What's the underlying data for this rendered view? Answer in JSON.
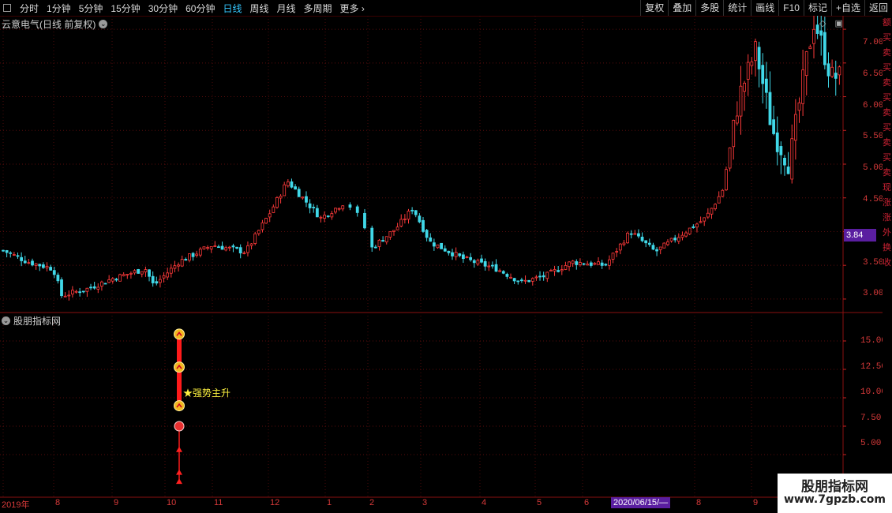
{
  "toolbar": {
    "periods": [
      "分时",
      "1分钟",
      "5分钟",
      "15分钟",
      "30分钟",
      "60分钟",
      "日线",
      "周线",
      "月线",
      "多周期",
      "更多"
    ],
    "active_period": "日线",
    "right_tools": [
      "复权",
      "叠加",
      "多股",
      "统计",
      "画线",
      "F10",
      "标记",
      "+自选",
      "返回"
    ]
  },
  "main_panel": {
    "title": "云意电气(日线 前复权)",
    "current_price": "3.84",
    "y_ticks": [
      "7.00",
      "6.50",
      "6.00",
      "5.50",
      "5.00",
      "4.50",
      "4.00",
      "3.50",
      "3.00"
    ]
  },
  "indicator_panel": {
    "title": "股朋指标网",
    "y_ticks": [
      "15.00",
      "12.50",
      "10.00",
      "7.50",
      "5.00"
    ],
    "signal_label": "★强势主升"
  },
  "time_axis": {
    "labels": [
      "2019年",
      "8",
      "9",
      "10",
      "11",
      "12",
      "1",
      "2",
      "3",
      "4",
      "5",
      "6",
      "8",
      "9"
    ],
    "cursor_date": "2020/06/15/—"
  },
  "right_strip": [
    "额",
    "买",
    "卖",
    "买",
    "卖",
    "买",
    "卖",
    "买",
    "卖",
    "买",
    "卖",
    "现",
    "涨",
    "涨",
    "外",
    "换",
    "收"
  ],
  "watermark": {
    "name": "股朋指标网",
    "url": "www.7gpzb.com"
  },
  "colors": {
    "up": "#ff3a3a",
    "down": "#40d8e8",
    "accent": "#35c7ff",
    "highlight": "#5a1ea0"
  },
  "chart_data": {
    "type": "candlestick",
    "x_start": "2019-07",
    "x_end": "2020-09",
    "ylim": [
      2.8,
      7.2
    ],
    "close_path": [
      [
        0,
        3.72
      ],
      [
        0.03,
        3.55
      ],
      [
        0.06,
        3.45
      ],
      [
        0.07,
        3.05
      ],
      [
        0.1,
        3.15
      ],
      [
        0.13,
        3.3
      ],
      [
        0.17,
        3.45
      ],
      [
        0.18,
        3.2
      ],
      [
        0.21,
        3.55
      ],
      [
        0.25,
        3.8
      ],
      [
        0.29,
        3.7
      ],
      [
        0.32,
        4.3
      ],
      [
        0.34,
        4.75
      ],
      [
        0.38,
        4.2
      ],
      [
        0.41,
        4.45
      ],
      [
        0.43,
        4.15
      ],
      [
        0.44,
        3.75
      ],
      [
        0.47,
        4.05
      ],
      [
        0.49,
        4.35
      ],
      [
        0.51,
        3.85
      ],
      [
        0.55,
        3.6
      ],
      [
        0.59,
        3.45
      ],
      [
        0.62,
        3.25
      ],
      [
        0.65,
        3.35
      ],
      [
        0.68,
        3.55
      ],
      [
        0.72,
        3.5
      ],
      [
        0.75,
        4.0
      ],
      [
        0.78,
        3.7
      ],
      [
        0.81,
        3.95
      ],
      [
        0.84,
        4.2
      ],
      [
        0.86,
        4.6
      ],
      [
        0.88,
        6.0
      ],
      [
        0.9,
        6.7
      ],
      [
        0.92,
        5.5
      ],
      [
        0.94,
        5.0
      ],
      [
        0.96,
        6.5
      ],
      [
        0.97,
        7.15
      ],
      [
        0.99,
        6.3
      ]
    ]
  }
}
